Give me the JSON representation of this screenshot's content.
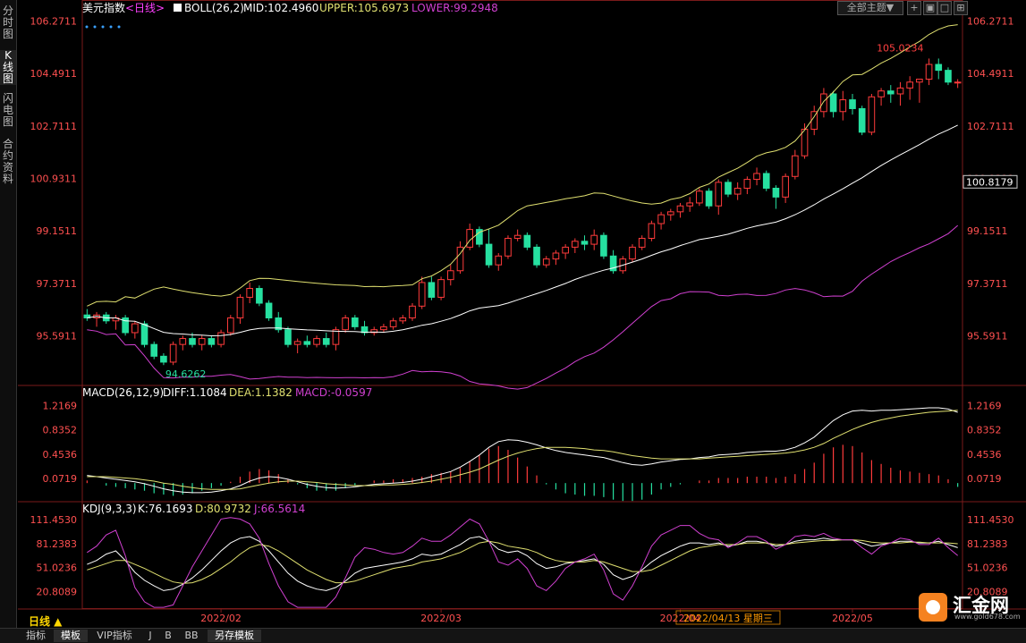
{
  "side_tabs": [
    "分时图",
    "K线图",
    "闪电图",
    "合约资料"
  ],
  "top_buttons": {
    "theme": "全部主题▼"
  },
  "period_label": "日线 ▲",
  "bottom_tabs": [
    "指标",
    "模板",
    "VIP指标",
    "J",
    "B",
    "BB",
    "另存模板"
  ],
  "logo": {
    "text": "汇金网",
    "url": "www.gold678.com"
  },
  "colors": {
    "up": "#ff3b3b",
    "down": "#26e0a0",
    "upper": "#e0e070",
    "mid": "#ffffff",
    "lower": "#d040d0",
    "diff": "#ffffff",
    "dea": "#e0e070",
    "j": "#d040d0"
  },
  "chart_data": [
    {
      "type": "candlestick",
      "header": {
        "name": "美元指数",
        "period": "<日线>",
        "boll": "BOLL(26,2)",
        "mid": "MID:102.4960",
        "upper": "UPPER:105.6973",
        "lower": "LOWER:99.2948"
      },
      "y_ticks": [
        "106.2711",
        "104.4911",
        "102.7111",
        "100.9311",
        "99.1511",
        "97.3711",
        "95.5911"
      ],
      "ylim": [
        94.0,
        106.5
      ],
      "last_price": "100.8179",
      "annotations": {
        "high": "105.0234",
        "low": "94.6262"
      },
      "x_labels": [
        "2022/02",
        "2022/03",
        "2022/04",
        "2022/04/13 星期三",
        "2022/05"
      ],
      "x_label_index": [
        14,
        37,
        62,
        67,
        80
      ],
      "ohlc": [
        [
          96.3,
          96.5,
          96.1,
          96.2
        ],
        [
          96.2,
          96.4,
          95.9,
          96.3
        ],
        [
          96.3,
          96.4,
          96.0,
          96.1
        ],
        [
          96.1,
          96.3,
          95.8,
          96.2
        ],
        [
          96.2,
          96.3,
          95.6,
          95.7
        ],
        [
          95.7,
          96.1,
          95.5,
          96.0
        ],
        [
          96.0,
          96.1,
          95.2,
          95.3
        ],
        [
          95.3,
          95.4,
          94.8,
          94.9
        ],
        [
          94.9,
          95.0,
          94.6,
          94.7
        ],
        [
          94.7,
          95.4,
          94.6,
          95.3
        ],
        [
          95.3,
          95.6,
          95.1,
          95.5
        ],
        [
          95.5,
          95.7,
          95.2,
          95.3
        ],
        [
          95.3,
          95.6,
          95.1,
          95.5
        ],
        [
          95.5,
          95.6,
          95.2,
          95.3
        ],
        [
          95.3,
          95.8,
          95.2,
          95.7
        ],
        [
          95.7,
          96.3,
          95.6,
          96.2
        ],
        [
          96.2,
          97.0,
          96.0,
          96.9
        ],
        [
          96.9,
          97.4,
          96.7,
          97.2
        ],
        [
          97.2,
          97.3,
          96.6,
          96.7
        ],
        [
          96.7,
          96.8,
          96.1,
          96.2
        ],
        [
          96.2,
          96.4,
          95.7,
          95.8
        ],
        [
          95.8,
          95.9,
          95.2,
          95.3
        ],
        [
          95.3,
          95.5,
          95.0,
          95.4
        ],
        [
          95.4,
          95.6,
          95.2,
          95.3
        ],
        [
          95.3,
          95.6,
          95.2,
          95.5
        ],
        [
          95.5,
          95.7,
          95.2,
          95.3
        ],
        [
          95.3,
          95.9,
          95.1,
          95.8
        ],
        [
          95.8,
          96.3,
          95.7,
          96.2
        ],
        [
          96.2,
          96.3,
          95.8,
          95.9
        ],
        [
          95.9,
          96.1,
          95.6,
          95.7
        ],
        [
          95.7,
          95.9,
          95.6,
          95.8
        ],
        [
          95.8,
          96.0,
          95.7,
          95.9
        ],
        [
          95.9,
          96.2,
          95.8,
          96.1
        ],
        [
          96.1,
          96.3,
          96.0,
          96.2
        ],
        [
          96.2,
          96.7,
          96.1,
          96.6
        ],
        [
          96.6,
          97.6,
          96.5,
          97.4
        ],
        [
          97.4,
          97.6,
          96.8,
          96.9
        ],
        [
          96.9,
          97.6,
          96.8,
          97.5
        ],
        [
          97.5,
          98.0,
          97.3,
          97.8
        ],
        [
          97.8,
          98.8,
          97.7,
          98.6
        ],
        [
          98.6,
          99.4,
          98.5,
          99.2
        ],
        [
          99.2,
          99.3,
          98.6,
          98.7
        ],
        [
          98.7,
          99.2,
          97.9,
          98.0
        ],
        [
          98.0,
          98.4,
          97.8,
          98.3
        ],
        [
          98.3,
          99.0,
          98.2,
          98.9
        ],
        [
          98.9,
          99.2,
          98.8,
          99.0
        ],
        [
          99.0,
          99.1,
          98.5,
          98.6
        ],
        [
          98.6,
          98.7,
          97.9,
          98.0
        ],
        [
          98.0,
          98.3,
          97.9,
          98.2
        ],
        [
          98.2,
          98.5,
          98.0,
          98.4
        ],
        [
          98.4,
          98.7,
          98.2,
          98.6
        ],
        [
          98.6,
          98.9,
          98.4,
          98.8
        ],
        [
          98.8,
          99.0,
          98.5,
          98.7
        ],
        [
          98.7,
          99.2,
          98.5,
          99.0
        ],
        [
          99.0,
          99.1,
          98.2,
          98.3
        ],
        [
          98.3,
          98.5,
          97.7,
          97.8
        ],
        [
          97.8,
          98.3,
          97.7,
          98.2
        ],
        [
          98.2,
          98.7,
          98.1,
          98.6
        ],
        [
          98.6,
          99.0,
          98.5,
          98.9
        ],
        [
          98.9,
          99.5,
          98.8,
          99.4
        ],
        [
          99.4,
          99.8,
          99.2,
          99.7
        ],
        [
          99.7,
          99.9,
          99.5,
          99.8
        ],
        [
          99.8,
          100.1,
          99.6,
          100.0
        ],
        [
          100.0,
          100.3,
          99.8,
          100.1
        ],
        [
          100.1,
          100.6,
          100.0,
          100.5
        ],
        [
          100.5,
          100.6,
          99.9,
          100.0
        ],
        [
          100.0,
          100.9,
          99.7,
          100.8
        ],
        [
          100.8,
          100.9,
          100.3,
          100.4
        ],
        [
          100.4,
          100.8,
          100.2,
          100.6
        ],
        [
          100.6,
          101.0,
          100.4,
          100.9
        ],
        [
          100.9,
          101.3,
          100.7,
          101.1
        ],
        [
          101.1,
          101.2,
          100.5,
          100.6
        ],
        [
          100.6,
          100.7,
          99.9,
          100.3
        ],
        [
          100.3,
          101.1,
          100.1,
          101.0
        ],
        [
          101.0,
          101.9,
          100.9,
          101.7
        ],
        [
          101.7,
          102.8,
          101.6,
          102.6
        ],
        [
          102.6,
          103.4,
          102.4,
          103.2
        ],
        [
          103.2,
          104.0,
          103.0,
          103.8
        ],
        [
          103.8,
          103.9,
          103.0,
          103.2
        ],
        [
          103.2,
          103.9,
          102.9,
          103.6
        ],
        [
          103.6,
          103.8,
          103.1,
          103.3
        ],
        [
          103.3,
          103.4,
          102.4,
          102.5
        ],
        [
          102.5,
          103.8,
          102.4,
          103.7
        ],
        [
          103.7,
          104.0,
          103.4,
          103.9
        ],
        [
          103.9,
          104.1,
          103.5,
          103.8
        ],
        [
          103.8,
          104.2,
          103.4,
          104.0
        ],
        [
          104.0,
          104.4,
          103.6,
          104.2
        ],
        [
          104.2,
          104.3,
          103.5,
          104.3
        ],
        [
          104.3,
          105.0,
          104.1,
          104.8
        ],
        [
          104.8,
          105.0,
          104.3,
          104.6
        ],
        [
          104.6,
          104.7,
          104.1,
          104.2
        ],
        [
          104.2,
          104.3,
          104.0,
          104.2
        ]
      ]
    },
    {
      "type": "macd",
      "header": {
        "name": "MACD(26,12,9)",
        "diff": "DIFF:1.1084",
        "dea": "DEA:1.1382",
        "macd": "MACD:-0.0597"
      },
      "y_ticks": [
        "1.2169",
        "0.8352",
        "0.4536",
        "0.0719"
      ],
      "ylim": [
        -0.25,
        1.32
      ],
      "diff": [
        0.12,
        0.1,
        0.08,
        0.06,
        0.04,
        0.02,
        -0.01,
        -0.05,
        -0.09,
        -0.12,
        -0.14,
        -0.15,
        -0.15,
        -0.14,
        -0.12,
        -0.09,
        -0.04,
        0.03,
        0.08,
        0.1,
        0.09,
        0.06,
        0.02,
        -0.02,
        -0.05,
        -0.07,
        -0.08,
        -0.07,
        -0.06,
        -0.04,
        -0.02,
        -0.01,
        0.0,
        0.01,
        0.03,
        0.06,
        0.1,
        0.14,
        0.18,
        0.25,
        0.34,
        0.44,
        0.56,
        0.65,
        0.68,
        0.67,
        0.64,
        0.6,
        0.55,
        0.51,
        0.48,
        0.46,
        0.44,
        0.42,
        0.4,
        0.36,
        0.32,
        0.29,
        0.28,
        0.3,
        0.33,
        0.35,
        0.37,
        0.38,
        0.4,
        0.41,
        0.44,
        0.45,
        0.46,
        0.48,
        0.49,
        0.5,
        0.5,
        0.52,
        0.56,
        0.63,
        0.72,
        0.85,
        0.98,
        1.07,
        1.13,
        1.14,
        1.13,
        1.14,
        1.14,
        1.15,
        1.16,
        1.17,
        1.18,
        1.18,
        1.16,
        1.11
      ],
      "dea": [
        0.1,
        0.1,
        0.1,
        0.09,
        0.08,
        0.07,
        0.05,
        0.03,
        0.0,
        -0.02,
        -0.05,
        -0.07,
        -0.09,
        -0.1,
        -0.1,
        -0.1,
        -0.09,
        -0.06,
        -0.03,
        0.0,
        0.02,
        0.03,
        0.03,
        0.02,
        0.01,
        -0.01,
        -0.02,
        -0.03,
        -0.04,
        -0.04,
        -0.04,
        -0.03,
        -0.03,
        -0.02,
        -0.01,
        0.01,
        0.03,
        0.06,
        0.09,
        0.13,
        0.17,
        0.22,
        0.29,
        0.36,
        0.42,
        0.47,
        0.51,
        0.54,
        0.56,
        0.56,
        0.56,
        0.55,
        0.54,
        0.52,
        0.51,
        0.49,
        0.46,
        0.43,
        0.41,
        0.39,
        0.38,
        0.38,
        0.38,
        0.38,
        0.38,
        0.39,
        0.4,
        0.41,
        0.42,
        0.43,
        0.44,
        0.45,
        0.46,
        0.47,
        0.49,
        0.52,
        0.56,
        0.62,
        0.7,
        0.77,
        0.84,
        0.9,
        0.95,
        0.99,
        1.02,
        1.05,
        1.07,
        1.09,
        1.11,
        1.12,
        1.13,
        1.14
      ]
    },
    {
      "type": "kdj",
      "header": {
        "name": "KDJ(9,3,3)",
        "k": "K:76.1693",
        "d": "D:80.9732",
        "j": "J:66.5614"
      },
      "y_ticks": [
        "111.4530",
        "81.2383",
        "51.0236",
        "20.8089"
      ],
      "ylim": [
        0,
        117
      ],
      "k": [
        55,
        60,
        68,
        72,
        60,
        45,
        35,
        28,
        22,
        24,
        30,
        38,
        48,
        60,
        72,
        82,
        88,
        90,
        84,
        72,
        58,
        44,
        34,
        28,
        24,
        22,
        26,
        34,
        44,
        50,
        52,
        54,
        56,
        58,
        62,
        68,
        66,
        68,
        74,
        80,
        88,
        90,
        84,
        74,
        70,
        72,
        66,
        56,
        50,
        52,
        56,
        58,
        60,
        62,
        55,
        42,
        36,
        40,
        48,
        58,
        66,
        72,
        78,
        82,
        82,
        80,
        82,
        78,
        80,
        84,
        84,
        82,
        78,
        80,
        84,
        86,
        86,
        88,
        86,
        86,
        86,
        82,
        78,
        80,
        82,
        84,
        84,
        82,
        82,
        84,
        80,
        76
      ],
      "d": [
        48,
        52,
        56,
        60,
        60,
        55,
        50,
        44,
        38,
        33,
        31,
        32,
        36,
        42,
        50,
        58,
        68,
        76,
        80,
        78,
        72,
        64,
        56,
        48,
        42,
        36,
        32,
        32,
        34,
        38,
        42,
        46,
        50,
        52,
        54,
        58,
        60,
        62,
        66,
        70,
        76,
        82,
        84,
        82,
        78,
        76,
        74,
        70,
        64,
        60,
        58,
        58,
        58,
        60,
        58,
        54,
        50,
        46,
        46,
        48,
        54,
        60,
        66,
        72,
        76,
        78,
        80,
        80,
        80,
        82,
        82,
        82,
        80,
        80,
        82,
        83,
        84,
        85,
        85,
        86,
        86,
        85,
        83,
        82,
        82,
        82,
        83,
        83,
        82,
        82,
        82,
        81
      ],
      "j": [
        70,
        78,
        92,
        98,
        66,
        26,
        8,
        -2,
        -6,
        4,
        28,
        52,
        72,
        92,
        112,
        114,
        112,
        106,
        88,
        56,
        28,
        8,
        -4,
        -10,
        -6,
        -2,
        14,
        38,
        64,
        76,
        74,
        70,
        68,
        70,
        78,
        88,
        84,
        84,
        92,
        102,
        112,
        106,
        84,
        58,
        54,
        62,
        50,
        28,
        22,
        34,
        50,
        58,
        62,
        68,
        48,
        18,
        10,
        28,
        52,
        78,
        92,
        98,
        104,
        104,
        94,
        88,
        86,
        76,
        82,
        90,
        90,
        84,
        74,
        80,
        90,
        92,
        90,
        94,
        88,
        86,
        86,
        76,
        68,
        78,
        82,
        88,
        86,
        80,
        80,
        88,
        76,
        66
      ]
    }
  ]
}
